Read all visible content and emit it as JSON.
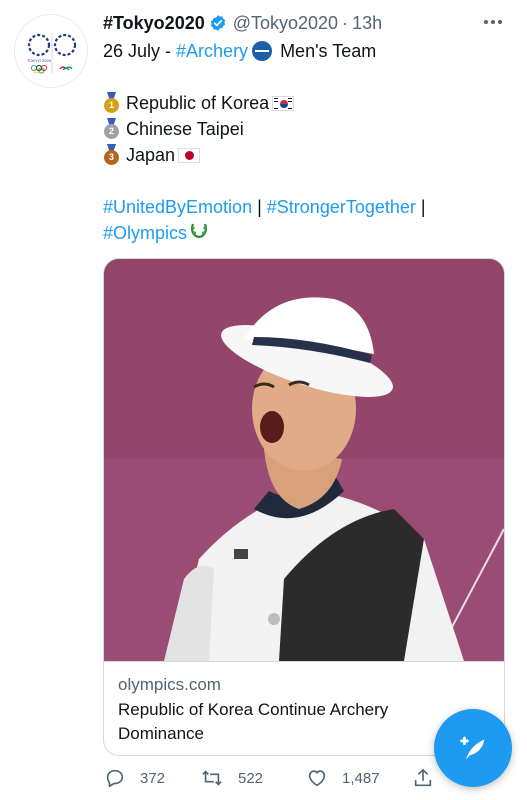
{
  "account": {
    "display_name": "#Tokyo2020",
    "handle": "@Tokyo2020",
    "separator": "·",
    "timestamp": "13h",
    "avatar_text": "TOKYO 2020"
  },
  "tweet": {
    "date_prefix": "26 July - ",
    "sport_hashtag": "#Archery",
    "event": "Men's Team",
    "results": [
      {
        "rank": "1",
        "team": "Republic of Korea",
        "flag": "flag-kr-icon",
        "medal_color": "#d4a017"
      },
      {
        "rank": "2",
        "team": "Chinese Taipei",
        "flag": "",
        "medal_color": "#9aa3ab"
      },
      {
        "rank": "3",
        "team": "Japan",
        "flag": "flag-jp-icon",
        "medal_color": "#b5651d"
      }
    ],
    "hashtags": {
      "h1": "#UnitedByEmotion",
      "sep1": " | ",
      "h2": "#StrongerTogether",
      "sep2": " |",
      "h3": "#Olympics"
    }
  },
  "card": {
    "domain": "olympics.com",
    "title": "Republic of Korea Continue Archery Dominance",
    "image_desc_icon": "archer-photo-icon"
  },
  "actions": {
    "replies": "372",
    "retweets": "522",
    "likes": "1,487"
  },
  "colors": {
    "accent": "#1d9bf0",
    "text": "#0f1419",
    "muted": "#536471"
  }
}
